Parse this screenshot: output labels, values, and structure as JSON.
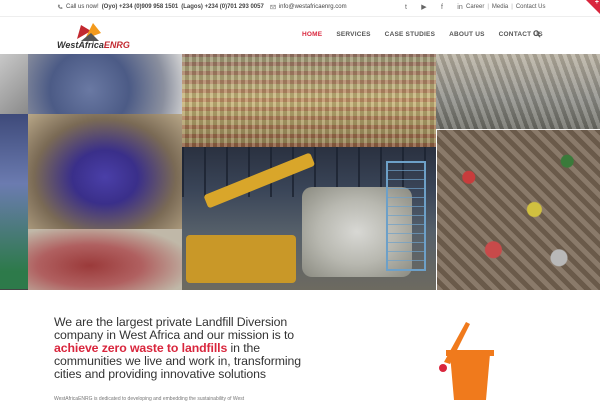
{
  "topbar": {
    "contact_label": "Call us now!",
    "phone_oyo": "(Oyo) +234 (0)909 958 1501",
    "phone_lagos": "(Lagos) +234 (0)701 293 0057",
    "email": "info@westafricaenrg.com",
    "social": [
      {
        "icon": "twitter-icon",
        "glyph": "t"
      },
      {
        "icon": "youtube-icon",
        "glyph": "▶"
      },
      {
        "icon": "facebook-icon",
        "glyph": "f"
      },
      {
        "icon": "linkedin-icon",
        "glyph": "in"
      }
    ],
    "links": [
      "Career",
      "Media",
      "Contact Us"
    ]
  },
  "logo": {
    "brand_prefix": "WestAfrica",
    "brand_suffix": "ENRG",
    "colors": {
      "red": "#c2282f",
      "orange": "#f39a1c",
      "gray": "#555555"
    }
  },
  "nav": {
    "items": [
      "HOME",
      "SERVICES",
      "CASE STUDIES",
      "ABOUT US",
      "CONTACT US"
    ],
    "active_index": 0,
    "accent_color": "#d9263d"
  },
  "mission": {
    "line_start": "We are the largest private Landfill Diversion company in West Africa and our mission is to ",
    "highlight": "achieve zero waste to landfills",
    "line_end": " in the communities we live and work in, transforming cities and providing innovative solutions",
    "small_text": "WestAfricaENRG is dedicated to developing and embedding the sustainability of West",
    "bucket_color": "#f07a1c",
    "bucket_accent": "#d9263d"
  }
}
